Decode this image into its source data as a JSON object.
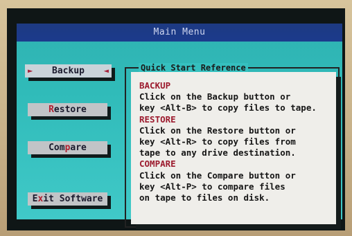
{
  "window": {
    "title": "Main Menu"
  },
  "menu": {
    "buttons": [
      {
        "label": "Backup",
        "hotkey_letter": "B",
        "selected": true
      },
      {
        "label": "Restore",
        "hotkey_letter": "R",
        "selected": false
      },
      {
        "label": "Compare",
        "hotkey_letter": "p",
        "selected": false
      },
      {
        "label": "Exit Software",
        "hotkey_letter": "x",
        "selected": false
      }
    ]
  },
  "quick_start": {
    "title": "Quick Start Reference",
    "sections": [
      {
        "heading": "BACKUP",
        "lines": [
          "Click on the Backup button or",
          "key <Alt-B> to copy files to tape."
        ]
      },
      {
        "heading": "RESTORE",
        "lines": [
          "Click on the Restore button or",
          "key <Alt-R> to copy files from",
          "tape to any drive destination."
        ]
      },
      {
        "heading": "COMPARE",
        "lines": [
          "Click on the Compare button or",
          "key <Alt-P> to compare files",
          "on tape to files on disk."
        ]
      }
    ]
  },
  "colors": {
    "titlebar": "#1c3a8c",
    "window_background": "#30bbb9",
    "panel_background": "#efeeea",
    "accent_red": "#9c1b2e"
  }
}
